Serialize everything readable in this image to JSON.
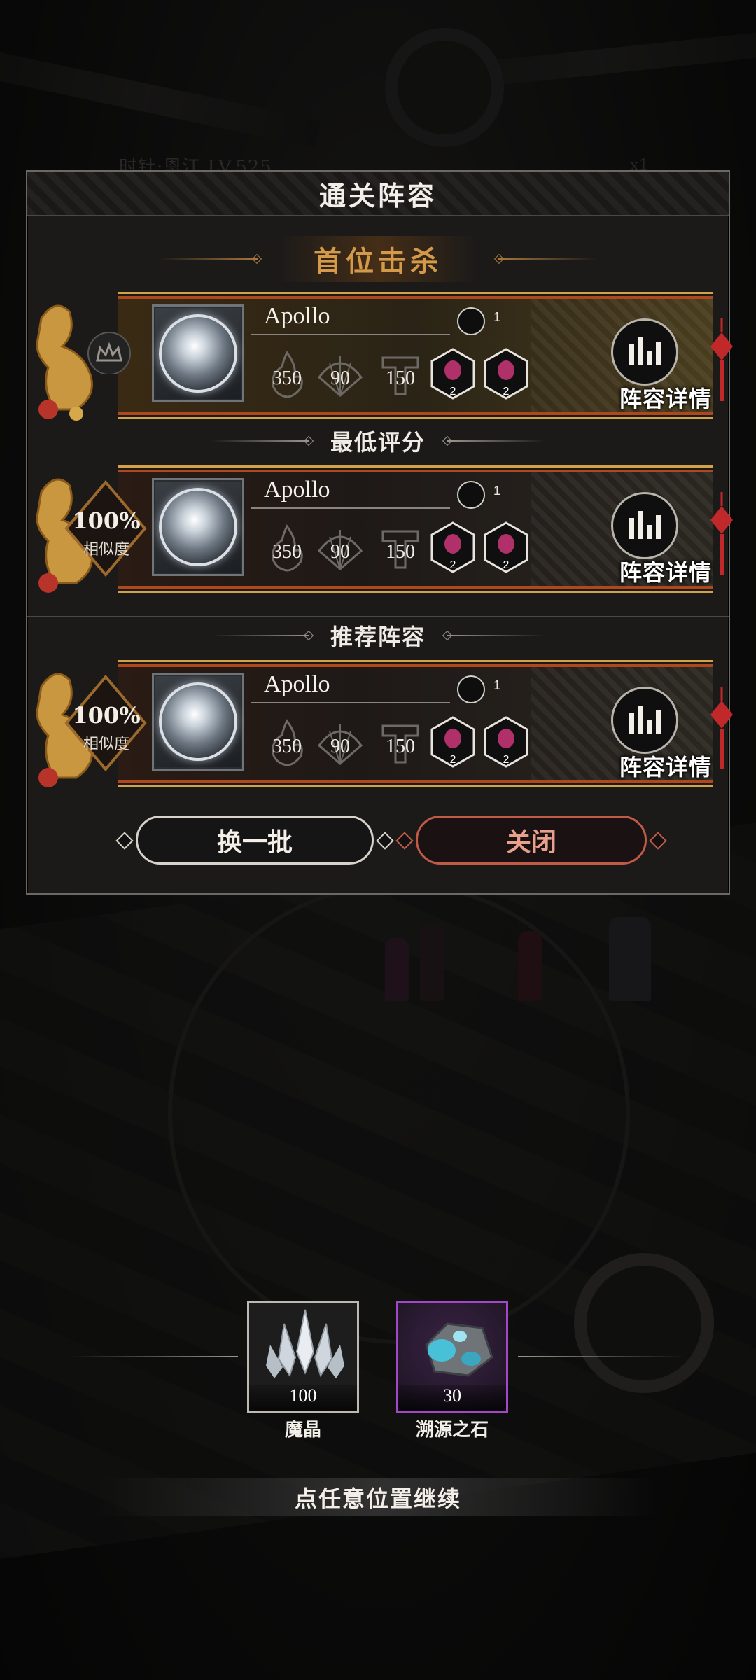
{
  "background": {
    "stage_label": "时针·恩江 LV.525",
    "multiplier": "x1"
  },
  "dialog": {
    "title": "通关阵容",
    "sections": [
      {
        "title": "首位击杀",
        "style": "gold",
        "card": {
          "hero_name": "Apollo",
          "likes": "1",
          "stats": [
            "350",
            "90",
            "150"
          ],
          "gem_counts": [
            "2",
            "2"
          ],
          "similarity": null,
          "detail_label": "阵容详情"
        }
      },
      {
        "title": "最低评分",
        "style": "plain",
        "card": {
          "hero_name": "Apollo",
          "likes": "1",
          "stats": [
            "350",
            "90",
            "150"
          ],
          "gem_counts": [
            "2",
            "2"
          ],
          "similarity": "100%",
          "similarity_label": "相似度",
          "detail_label": "阵容详情"
        }
      },
      {
        "title": "推荐阵容",
        "style": "plain",
        "card": {
          "hero_name": "Apollo",
          "likes": "1",
          "stats": [
            "350",
            "90",
            "150"
          ],
          "gem_counts": [
            "2",
            "2"
          ],
          "similarity": "100%",
          "similarity_label": "相似度",
          "detail_label": "阵容详情"
        }
      }
    ],
    "buttons": {
      "refresh": "换一批",
      "close": "关闭"
    }
  },
  "rewards": [
    {
      "name": "魔晶",
      "count": "100",
      "rarity": "common",
      "icon": "crystal-icon"
    },
    {
      "name": "溯源之石",
      "count": "30",
      "rarity": "epic",
      "icon": "ore-stone-icon"
    }
  ],
  "continue_hint": "点任意位置继续",
  "colors": {
    "accent_gold": "#d49a4a",
    "card_red": "#b0481e",
    "epic_purple": "#a347c8",
    "close_red": "#c25a48"
  }
}
